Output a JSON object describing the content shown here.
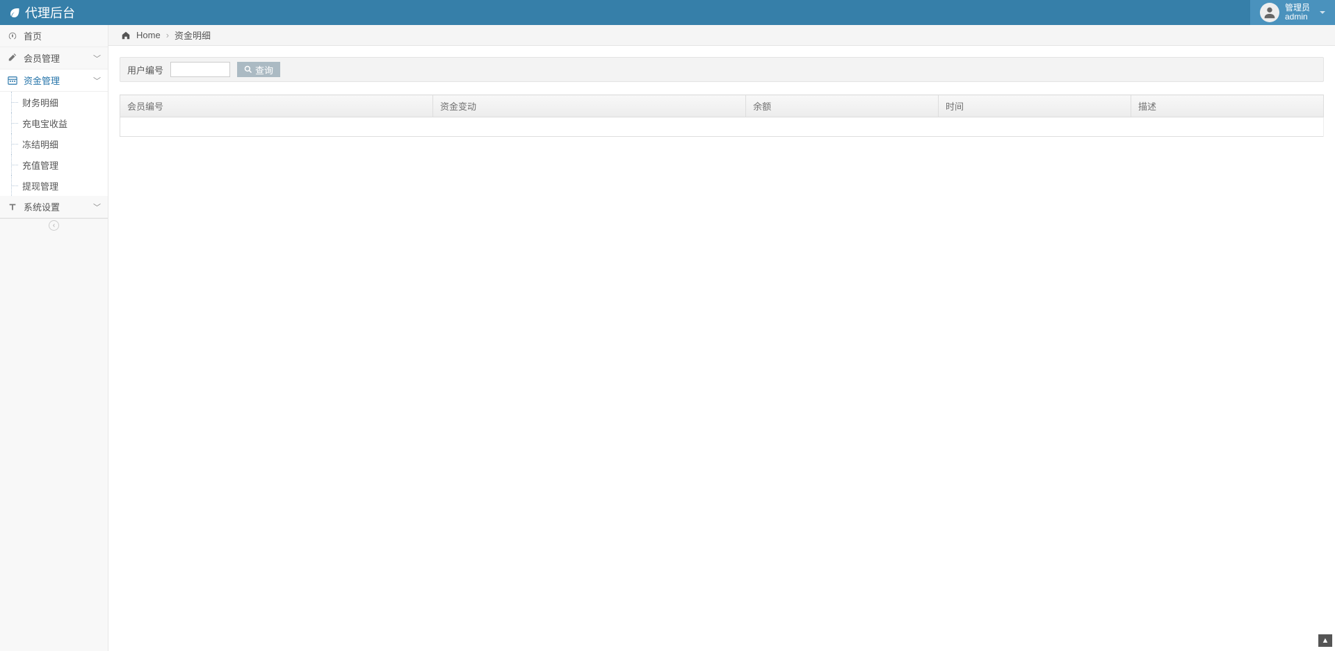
{
  "brand": {
    "title": "代理后台"
  },
  "user": {
    "role": "管理员",
    "name": "admin"
  },
  "sidebar": {
    "items": [
      {
        "label": "首页",
        "icon": "dashboard-icon"
      },
      {
        "label": "会员管理",
        "icon": "edit-icon",
        "expandable": true
      },
      {
        "label": "资金管理",
        "icon": "calendar-icon",
        "expandable": true,
        "active": true
      },
      {
        "label": "系统设置",
        "icon": "text-icon",
        "expandable": true
      }
    ],
    "submenu_funds": [
      {
        "label": "财务明细"
      },
      {
        "label": "充电宝收益"
      },
      {
        "label": "冻结明细"
      },
      {
        "label": "充值管理"
      },
      {
        "label": "提现管理"
      }
    ]
  },
  "breadcrumb": {
    "home": "Home",
    "current": "资金明细"
  },
  "filter": {
    "label": "用户编号",
    "value": "",
    "search_button": "查询"
  },
  "table": {
    "columns": [
      "会员编号",
      "资金变动",
      "余额",
      "时间",
      "描述"
    ]
  }
}
